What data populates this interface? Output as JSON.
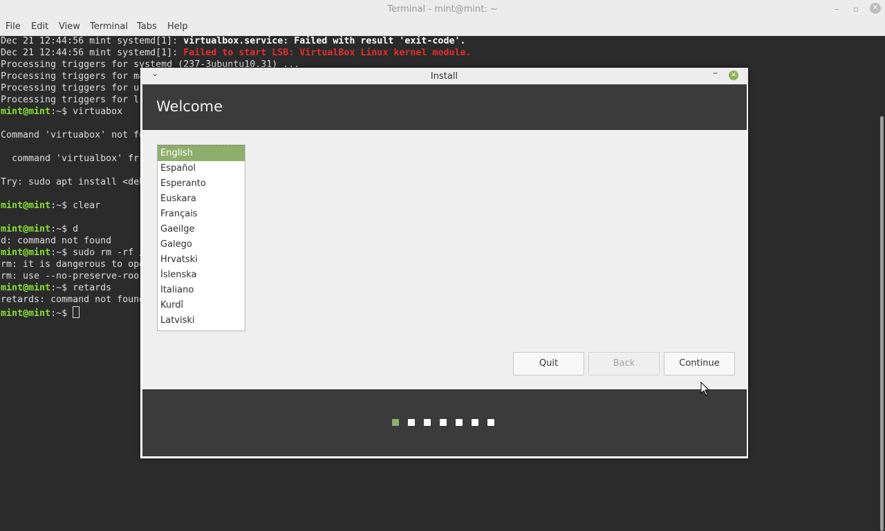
{
  "terminal": {
    "title": "Terminal - mint@mint: ~",
    "menu": [
      "File",
      "Edit",
      "View",
      "Terminal",
      "Tabs",
      "Help"
    ],
    "lines": [
      {
        "type": "systemd",
        "prefix": "Dec 21 12:44:56 mint systemd[1]: ",
        "text": "virtualbox.service: Failed with result 'exit-code'."
      },
      {
        "type": "systemd-red",
        "prefix": "Dec 21 12:44:56 mint systemd[1]: ",
        "text": "Failed to start LSB: VirtualBox Linux kernel module."
      },
      {
        "type": "plain",
        "text": "Processing triggers for systemd (237-3ubuntu10.31) ..."
      },
      {
        "type": "plain",
        "text": "Processing triggers for ma"
      },
      {
        "type": "plain",
        "text": "Processing triggers for u"
      },
      {
        "type": "plain",
        "text": "Processing triggers for l"
      },
      {
        "type": "prompt",
        "prompt": "mint@mint",
        "path": ":~$ ",
        "cmd": "virtuabox"
      },
      {
        "type": "plain",
        "text": ""
      },
      {
        "type": "plain",
        "text": "Command 'virtuabox' not fo"
      },
      {
        "type": "plain",
        "text": ""
      },
      {
        "type": "plain",
        "text": "  command 'virtualbox' fr"
      },
      {
        "type": "plain",
        "text": ""
      },
      {
        "type": "plain",
        "text": "Try: sudo apt install <deb"
      },
      {
        "type": "plain",
        "text": ""
      },
      {
        "type": "prompt",
        "prompt": "mint@mint",
        "path": ":~$ ",
        "cmd": "clear"
      },
      {
        "type": "plain",
        "text": ""
      },
      {
        "type": "prompt",
        "prompt": "mint@mint",
        "path": ":~$ ",
        "cmd": "d"
      },
      {
        "type": "plain",
        "text": "d: command not found"
      },
      {
        "type": "prompt",
        "prompt": "mint@mint",
        "path": ":~$ ",
        "cmd": "sudo rm -rf /"
      },
      {
        "type": "plain",
        "text": "rm: it is dangerous to ope"
      },
      {
        "type": "plain",
        "text": "rm: use --no-preserve-roo"
      },
      {
        "type": "prompt",
        "prompt": "mint@mint",
        "path": ":~$ ",
        "cmd": "retards"
      },
      {
        "type": "plain",
        "text": "retards: command not found"
      },
      {
        "type": "prompt-cursor",
        "prompt": "mint@mint",
        "path": ":~$ ",
        "cmd": ""
      }
    ]
  },
  "dialog": {
    "title": "Install",
    "heading": "Welcome",
    "languages": [
      "English",
      "Español",
      "Esperanto",
      "Euskara",
      "Français",
      "Gaeilge",
      "Galego",
      "Hrvatski",
      "Íslenska",
      "Italiano",
      "Kurdî",
      "Latviski"
    ],
    "selected_language": "English",
    "buttons": {
      "quit": "Quit",
      "back": "Back",
      "continue": "Continue"
    },
    "steps_total": 7,
    "current_step": 1,
    "colors": {
      "accent": "#8fae6b",
      "header_bg": "#3b3b3b"
    }
  }
}
